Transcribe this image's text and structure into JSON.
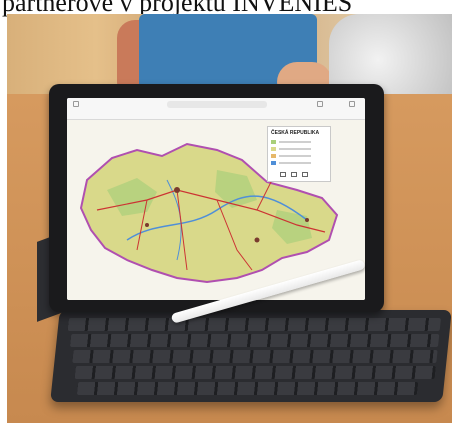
{
  "caption": {
    "text": "partnerové v projektu INVENIES"
  },
  "photo": {
    "subject": "tablet-with-map-on-keyboard",
    "tablet_screen": {
      "map_legend_title": "ČESKÁ REPUBLIKA"
    }
  },
  "colors": {
    "table": "#cf9257",
    "tablet_frame": "#1a1a1c",
    "map_fill": "#d9d98a",
    "map_border": "#b04fb0",
    "roads": "#cc3333",
    "rivers": "#4f8fd8",
    "keyboard": "#2b2c30",
    "background_tablet": "#3e7fb5"
  }
}
